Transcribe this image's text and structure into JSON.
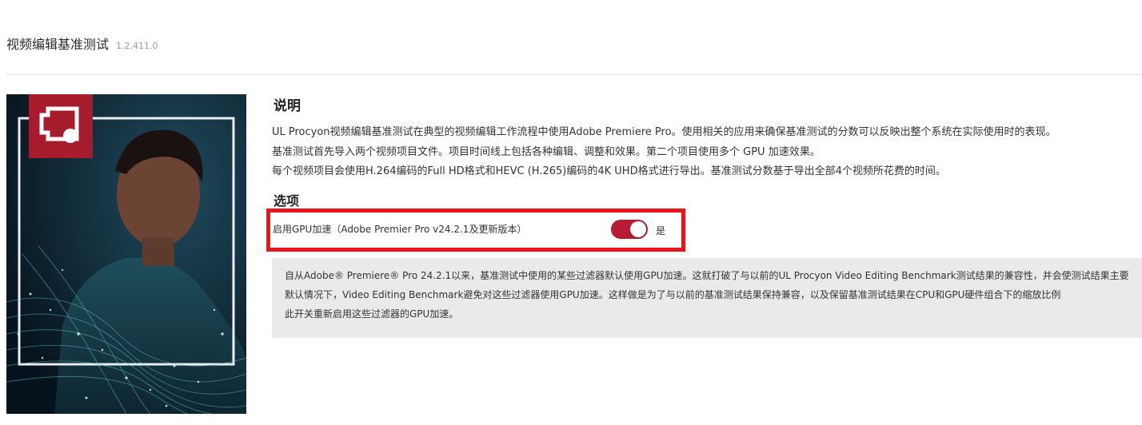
{
  "header": {
    "title": "视频编辑基准测试",
    "version": "1.2.411.0"
  },
  "hero": {
    "icon": "video-editing-icon",
    "accent_color": "#a61c2c"
  },
  "description": {
    "heading": "说明",
    "lines": [
      "UL Procyon视频编辑基准测试在典型的视频编辑工作流程中使用Adobe Premiere Pro。使用相关的应用来确保基准测试的分数可以反映出整个系统在实际使用时的表现。",
      "基准测试首先导入两个视频项目文件。项目时间线上包括各种编辑、调整和效果。第二个项目使用多个 GPU 加速效果。",
      "每个视频项目会使用H.264编码的Full HD格式和HEVC (H.265)编码的4K UHD格式进行导出。基准测试分数基于导出全部4个视频所花费的时间。"
    ]
  },
  "options": {
    "heading": "选项",
    "gpu_label": "启用GPU加速（Adobe Premier Pro v24.2.1及更新版本）",
    "toggle_state": "是",
    "toggle_on": true,
    "toggle_color": "#b71c32",
    "highlight_color": "#e8141d"
  },
  "note": {
    "lines": [
      "自从Adobe® Premiere® Pro 24.2.1以来，基准测试中使用的某些过滤器默认使用GPU加速。这就打破了与以前的UL Procyon Video Editing Benchmark测试结果的兼容性，并会使测试结果主要",
      "默认情况下，Video Editing Benchmark避免对这些过滤器使用GPU加速。这样做是为了与以前的基准测试结果保持兼容，以及保留基准测试结果在CPU和GPU硬件组合下的缩放比例",
      "此开关重新启用这些过滤器的GPU加速。"
    ]
  }
}
